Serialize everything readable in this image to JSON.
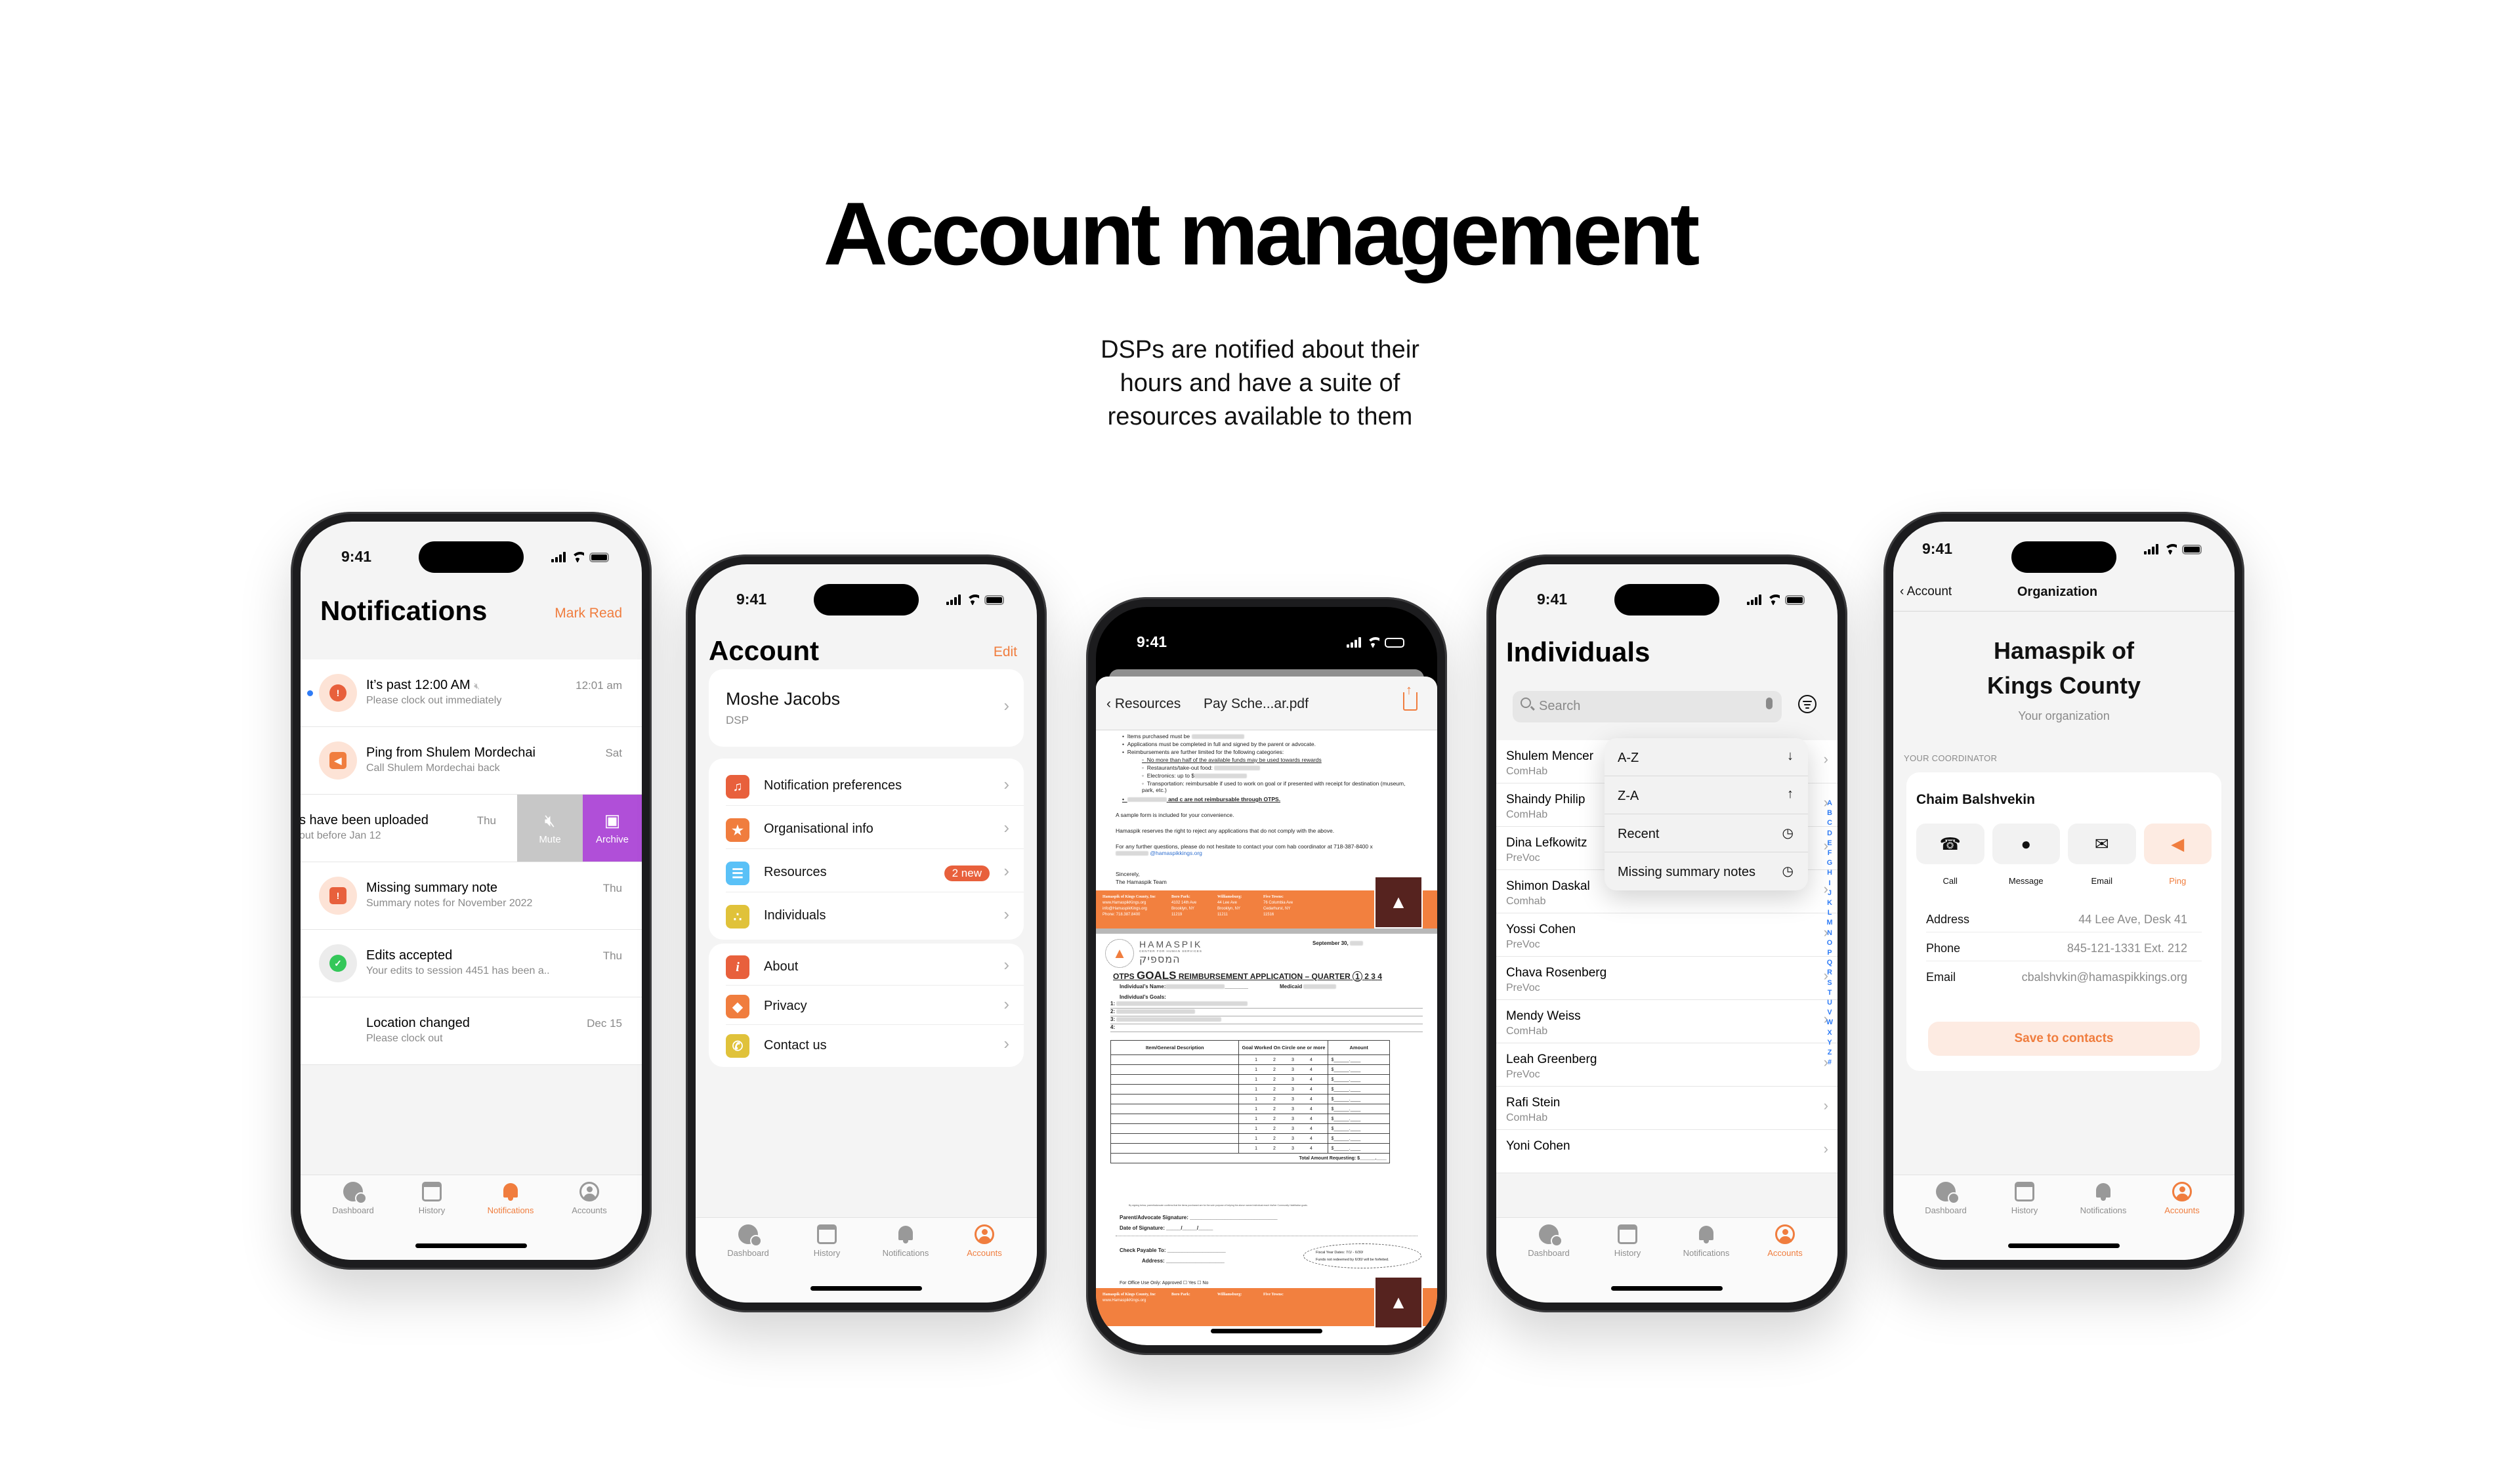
{
  "header": {
    "title": "Account management",
    "subtitle_lines": [
      "DSPs are notified about their",
      "hours and have a suite of",
      "resources available to them"
    ]
  },
  "status_bar": {
    "time": "9:41"
  },
  "tabbar": {
    "tabs": [
      {
        "label": "Dashboard",
        "icon": "dashboard-clock-check-icon"
      },
      {
        "label": "History",
        "icon": "calendar-icon"
      },
      {
        "label": "Notifications",
        "icon": "bell-icon"
      },
      {
        "label": "Accounts",
        "icon": "account-circle-icon"
      }
    ]
  },
  "colors": {
    "accent": "#f07d3e",
    "danger": "#e8603c",
    "archive": "#b04fd8",
    "mute": "#c7c7c7",
    "index_blue": "#2f7cf6",
    "success": "#34c759"
  },
  "notifications_screen": {
    "title": "Notifications",
    "action": "Mark Read",
    "active_tab": "Notifications",
    "items": [
      {
        "title": "It’s past 12:00 AM",
        "subtitle": "Please clock out immediately",
        "time": "12:01 am",
        "unread": true,
        "muted": true,
        "icon": "clock-alert-icon"
      },
      {
        "title": "Ping from Shulem Mordechai",
        "subtitle": "Call Shulem Mordechai back",
        "time": "Sat",
        "icon": "ping-speaker-icon"
      },
      {
        "title": "s have been uploaded",
        "subtitle": "out before Jan 12",
        "time": "Thu",
        "swiped": true,
        "actions": [
          "Mute",
          "Archive"
        ]
      },
      {
        "title": "Missing summary note",
        "subtitle": "Summary notes for November 2022",
        "time": "Thu",
        "icon": "calendar-alert-icon"
      },
      {
        "title": "Edits accepted",
        "subtitle": "Your edits to session 4451 has been a..",
        "time": "Thu",
        "icon": "clock-check-icon"
      },
      {
        "title": "Location changed",
        "subtitle": "Please clock out",
        "time": "Dec 15"
      }
    ]
  },
  "account_screen": {
    "title": "Account",
    "action": "Edit",
    "active_tab": "Accounts",
    "profile": {
      "name": "Moshe Jacobs",
      "role": "DSP"
    },
    "group1": [
      {
        "label": "Notification preferences",
        "icon": "bell-ring-icon",
        "color": "#e8603c"
      },
      {
        "label": "Organisational info",
        "icon": "person-star-icon",
        "color": "#f07d3e"
      },
      {
        "label": "Resources",
        "icon": "documents-icon",
        "color": "#5ac1f7",
        "badge": "2 new"
      },
      {
        "label": "Individuals",
        "icon": "group-icon",
        "color": "#e0c23a"
      }
    ],
    "group2": [
      {
        "label": "About",
        "icon": "info-icon",
        "color": "#e8603c"
      },
      {
        "label": "Privacy",
        "icon": "shield-icon",
        "color": "#f07d3e"
      },
      {
        "label": "Contact us",
        "icon": "phone-icon",
        "color": "#e0c23a"
      }
    ]
  },
  "pdf_screen": {
    "back_label": "Resources",
    "file_title": "Pay Sche...ar.pdf",
    "letter": {
      "bullets": [
        "Items purchased must be",
        "Applications must be completed in full and signed by the parent or advocate.",
        "Reimbursements are further limited for the following categories:"
      ],
      "sub_bullets": [
        "No more than half of the available funds may be used towards rewards",
        "Restaurants/take-out food:",
        "Electronics: up to $",
        "Transportation: reimbursable if used to work on goal or if presented with receipt for destination (museum, park, etc.)"
      ],
      "last_bullet": "and c are not reimbursable through OTPS.",
      "p1": "A sample form is included for your convenience.",
      "p2": "Hamaspik reserves the right to reject any applications that do not comply with the above.",
      "p3": "For any further questions, please do not hesitate to contact your com hab coordinator at 718-387-8400 x",
      "email_fragment": "@hamaspikkings.org",
      "closing": "Sincerely,",
      "signature": "The Hamaspik Team"
    },
    "footer": {
      "org": "Hamaspik of Kings County, Inc",
      "web": "www.HamaspikKings.org",
      "mail": "info@HamaspikKings.org",
      "phone": "Phone: 718.387.8400",
      "locations": [
        {
          "name": "Boro Park:",
          "lines": [
            "4102 14th Ave",
            "Brooklyn, NY",
            "11219"
          ]
        },
        {
          "name": "Williamsburg:",
          "lines": [
            "44 Lee Ave",
            "Brooklyn, NY",
            "11211"
          ]
        },
        {
          "name": "Five Towns:",
          "lines": [
            "76 Columbia Ave",
            "Cedarhurst, NY",
            "11516"
          ]
        }
      ]
    },
    "form": {
      "brand": "HAMASPIK",
      "brand_sub": "CENTER FOR HUMAN SERVICES",
      "brand_hebrew": "המספיק",
      "date": "September 30,",
      "title_pre": "OTPS",
      "title_big": "GOALS",
      "title_post": "REIMBURSEMENT APPLICATION – QUARTER",
      "quarters": [
        "1",
        "2",
        "3",
        "4"
      ],
      "selected_quarter": "1",
      "name_label": "Individual’s Name:",
      "medicaid_label": "Medicaid",
      "goals_label": "Individual’s Goals:",
      "goal_numbers": [
        "1:",
        "2:",
        "3:",
        "4:"
      ],
      "table_headers": [
        "Item/General Description",
        "Goal Worked On Circle one or more",
        "Amount"
      ],
      "row_count": 10,
      "goal_options": [
        "1",
        "2",
        "3",
        "4"
      ],
      "amount_placeholder": "$______.____",
      "total_label": "Total Amount Requesting: $______.____",
      "disclaimer": "By signing below, parent/advocate confirms that the items purchased are for the sole purpose of helping the above named individual reach his/her Community Habilitation goals.",
      "signature_label": "Parent/Advocate Signature: ______________________________",
      "date_label": "Date of Signature:   _____/_____/_____",
      "check_label": "Check Payable To: ____________________",
      "address_label": "Address: ____________________",
      "fiscal_line1": "Fiscal Year Dates: 7/1/     - 6/30/",
      "fiscal_line2": "Funds not redeemed by 6/30/      will be forfeited.",
      "office_label": "For Office Use Only: Approved ☐ Yes  ☐ No"
    }
  },
  "individuals_screen": {
    "title": "Individuals",
    "search_placeholder": "Search",
    "active_tab": "Accounts",
    "sort_menu": [
      {
        "label": "A-Z",
        "icon": "arrow-down-icon",
        "glyph": "↓"
      },
      {
        "label": "Z-A",
        "icon": "arrow-up-icon",
        "glyph": "↑"
      },
      {
        "label": "Recent",
        "icon": "clock-icon",
        "glyph": "◷"
      },
      {
        "label": "Missing summary notes",
        "icon": "clock-question-icon",
        "glyph": "◷"
      }
    ],
    "people": [
      {
        "name": "Shulem Mencer",
        "program": "ComHab"
      },
      {
        "name": "Shaindy Philip",
        "program": "ComHab"
      },
      {
        "name": "Dina Lefkowitz",
        "program": "PreVoc"
      },
      {
        "name": "Shimon Daskal",
        "program": "Comhab"
      },
      {
        "name": "Yossi Cohen",
        "program": "PreVoc"
      },
      {
        "name": "Chava Rosenberg",
        "program": "PreVoc"
      },
      {
        "name": "Mendy Weiss",
        "program": "ComHab"
      },
      {
        "name": "Leah Greenberg",
        "program": "PreVoc"
      },
      {
        "name": "Rafi Stein",
        "program": "ComHab"
      },
      {
        "name": "Yoni Cohen",
        "program": ""
      }
    ],
    "alphabet": [
      "A",
      "B",
      "C",
      "D",
      "E",
      "F",
      "G",
      "H",
      "I",
      "J",
      "K",
      "L",
      "M",
      "N",
      "O",
      "P",
      "Q",
      "R",
      "S",
      "T",
      "U",
      "V",
      "W",
      "X",
      "Y",
      "Z",
      "#"
    ]
  },
  "organization_screen": {
    "back_label": "Account",
    "nav_title": "Organization",
    "org_name_lines": [
      "Hamaspik of",
      "Kings County"
    ],
    "org_subtitle": "Your organization",
    "section_caption": "YOUR COORDINATOR",
    "active_tab": "Accounts",
    "coordinator": {
      "name": "Chaim Balshvekin",
      "actions": [
        {
          "label": "Call",
          "icon": "phone-icon",
          "glyph": "☎"
        },
        {
          "label": "Message",
          "icon": "chat-bubble-icon",
          "glyph": "●"
        },
        {
          "label": "Email",
          "icon": "envelope-icon",
          "glyph": "✉"
        },
        {
          "label": "Ping",
          "icon": "ping-speaker-icon",
          "glyph": "◀"
        }
      ],
      "details": [
        {
          "key": "Address",
          "value": "44 Lee Ave, Desk 41"
        },
        {
          "key": "Phone",
          "value": "845-121-1331 Ext. 212"
        },
        {
          "key": "Email",
          "value": "cbalshvkin@hamaspikkings.org"
        }
      ],
      "save_button": "Save to contacts"
    }
  }
}
